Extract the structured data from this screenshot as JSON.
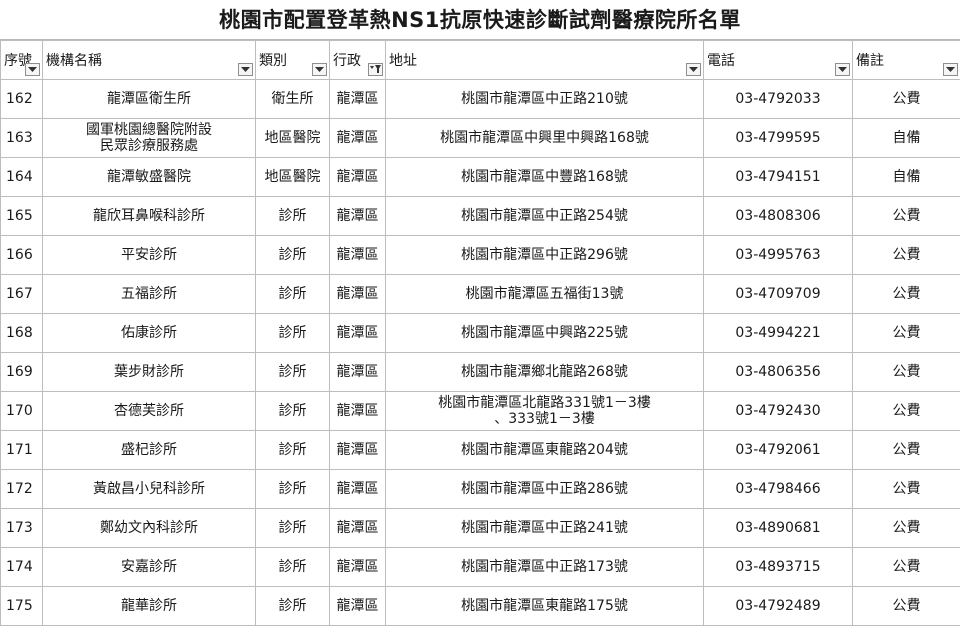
{
  "title": "桃園市配置登革熱NS1抗原快速診斷試劑醫療院所名單",
  "headers": [
    {
      "label": "序號",
      "display": "序號",
      "icon": "filter-dropdown-icon"
    },
    {
      "label": "機構名稱",
      "icon": "filter-dropdown-icon"
    },
    {
      "label": "類別",
      "icon": "filter-dropdown-icon"
    },
    {
      "label": "行政區",
      "display": "行政",
      "icon": "filter-active-icon"
    },
    {
      "label": "地址",
      "icon": "filter-dropdown-icon"
    },
    {
      "label": "電話",
      "icon": "filter-dropdown-icon"
    },
    {
      "label": "備註",
      "icon": "filter-dropdown-icon"
    }
  ],
  "rows": [
    {
      "seq": "162",
      "name": [
        "龍潭區衛生所"
      ],
      "category": "衛生所",
      "district": "龍潭區",
      "address": [
        "桃園市龍潭區中正路210號"
      ],
      "phone": "03-4792033",
      "note": "公費"
    },
    {
      "seq": "163",
      "name": [
        "國軍桃園總醫院附設",
        "民眾診療服務處"
      ],
      "category": "地區醫院",
      "district": "龍潭區",
      "address": [
        "桃園市龍潭區中興里中興路168號"
      ],
      "phone": "03-4799595",
      "note": "自備"
    },
    {
      "seq": "164",
      "name": [
        "龍潭敏盛醫院"
      ],
      "category": "地區醫院",
      "district": "龍潭區",
      "address": [
        "桃園市龍潭區中豐路168號"
      ],
      "phone": "03-4794151",
      "note": "自備"
    },
    {
      "seq": "165",
      "name": [
        "龍欣耳鼻喉科診所"
      ],
      "category": "診所",
      "district": "龍潭區",
      "address": [
        "桃園市龍潭區中正路254號"
      ],
      "phone": "03-4808306",
      "note": "公費"
    },
    {
      "seq": "166",
      "name": [
        "平安診所"
      ],
      "category": "診所",
      "district": "龍潭區",
      "address": [
        "桃園市龍潭區中正路296號"
      ],
      "phone": "03-4995763",
      "note": "公費"
    },
    {
      "seq": "167",
      "name": [
        "五福診所"
      ],
      "category": "診所",
      "district": "龍潭區",
      "address": [
        "桃園市龍潭區五福街13號"
      ],
      "phone": "03-4709709",
      "note": "公費"
    },
    {
      "seq": "168",
      "name": [
        "佑康診所"
      ],
      "category": "診所",
      "district": "龍潭區",
      "address": [
        "桃園市龍潭區中興路225號"
      ],
      "phone": "03-4994221",
      "note": "公費"
    },
    {
      "seq": "169",
      "name": [
        "葉步財診所"
      ],
      "category": "診所",
      "district": "龍潭區",
      "address": [
        "桃園市龍潭鄉北龍路268號"
      ],
      "phone": "03-4806356",
      "note": "公費"
    },
    {
      "seq": "170",
      "name": [
        "杏德芙診所"
      ],
      "category": "診所",
      "district": "龍潭區",
      "address": [
        "桃園市龍潭區北龍路331號1－3樓",
        "、333號1－3樓"
      ],
      "phone": "03-4792430",
      "note": "公費"
    },
    {
      "seq": "171",
      "name": [
        "盛杞診所"
      ],
      "category": "診所",
      "district": "龍潭區",
      "address": [
        "桃園市龍潭區東龍路204號"
      ],
      "phone": "03-4792061",
      "note": "公費"
    },
    {
      "seq": "172",
      "name": [
        "黃啟昌小兒科診所"
      ],
      "category": "診所",
      "district": "龍潭區",
      "address": [
        "桃園市龍潭區中正路286號"
      ],
      "phone": "03-4798466",
      "note": "公費"
    },
    {
      "seq": "173",
      "name": [
        "鄭幼文內科診所"
      ],
      "category": "診所",
      "district": "龍潭區",
      "address": [
        "桃園市龍潭區中正路241號"
      ],
      "phone": "03-4890681",
      "note": "公費"
    },
    {
      "seq": "174",
      "name": [
        "安嘉診所"
      ],
      "category": "診所",
      "district": "龍潭區",
      "address": [
        "桃園市龍潭區中正路173號"
      ],
      "phone": "03-4893715",
      "note": "公費"
    },
    {
      "seq": "175",
      "name": [
        "龍華診所"
      ],
      "category": "診所",
      "district": "龍潭區",
      "address": [
        "桃園市龍潭區東龍路175號"
      ],
      "phone": "03-4792489",
      "note": "公費"
    }
  ]
}
